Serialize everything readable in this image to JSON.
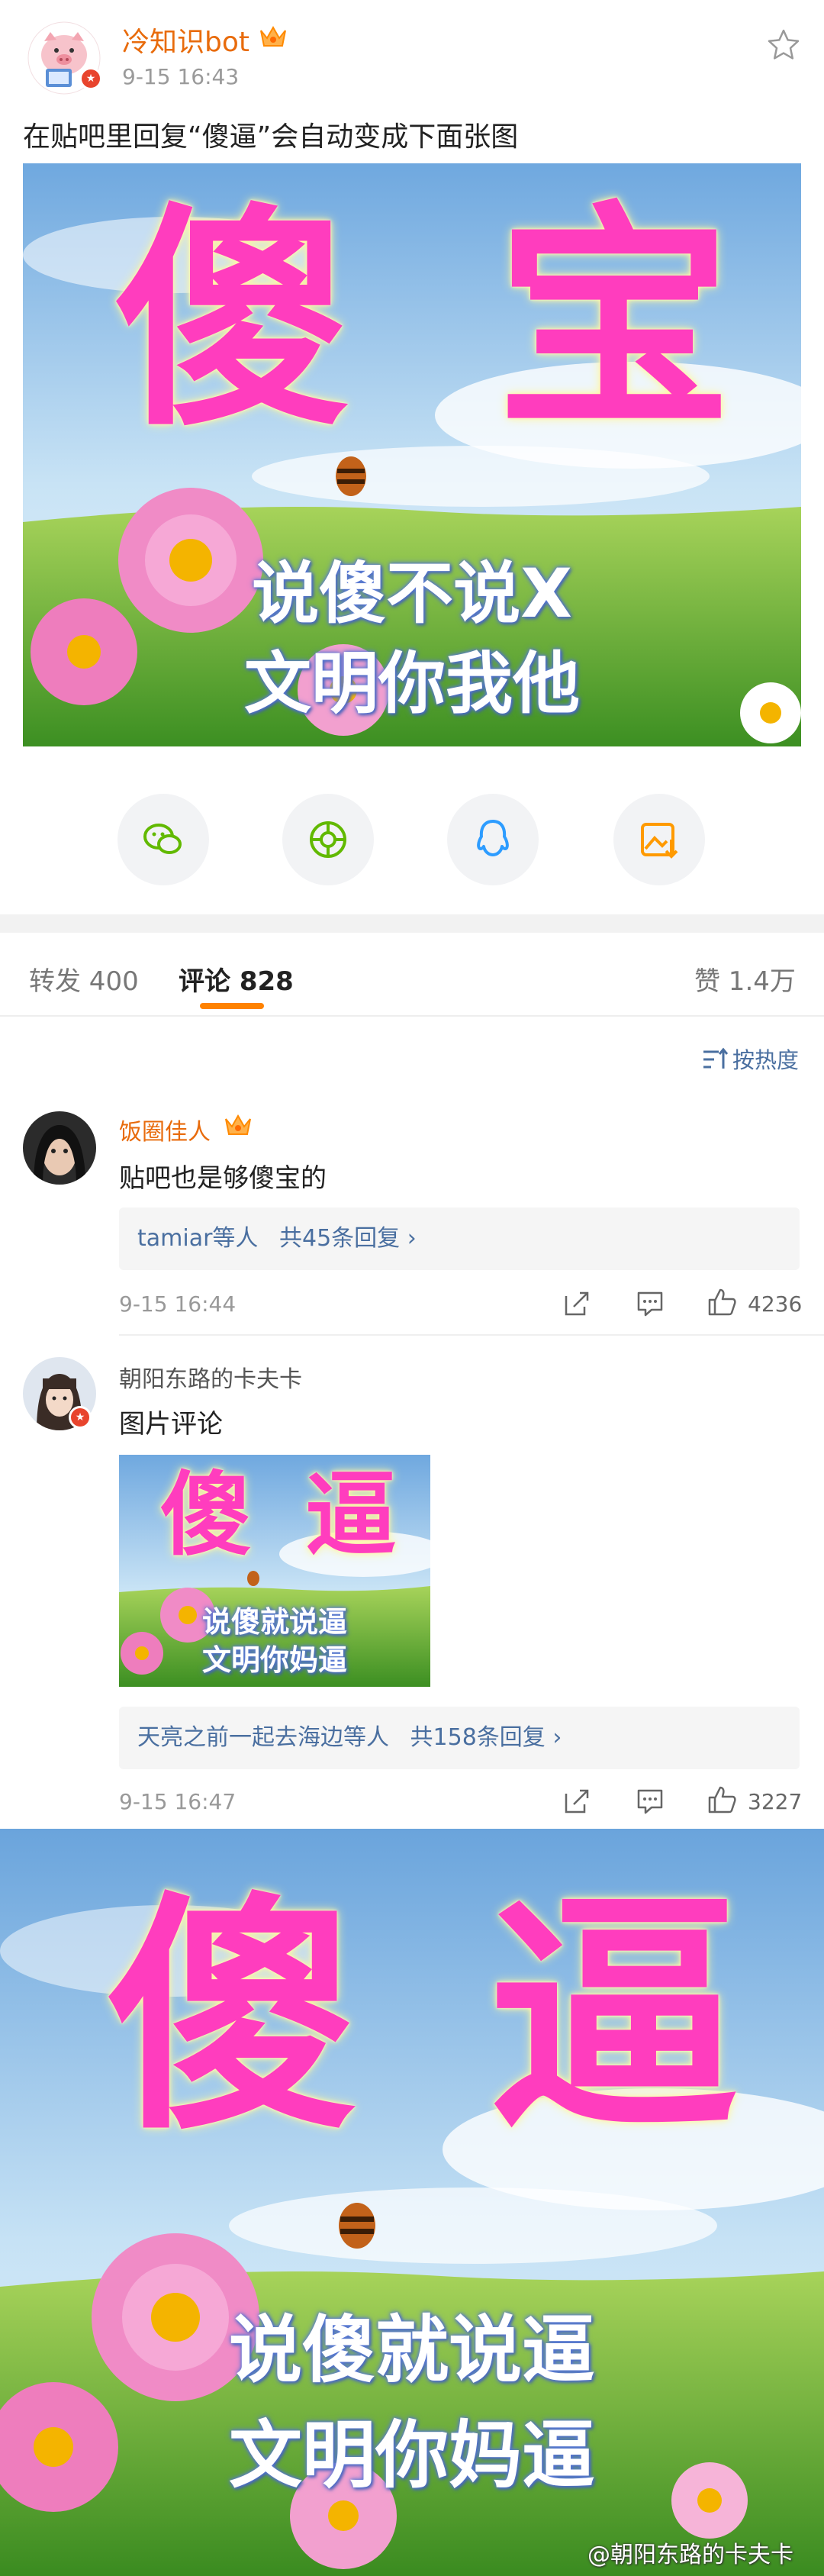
{
  "post": {
    "author": "冷知识bot",
    "time": "9-15 16:43",
    "text": "在贴吧里回复“傻逼”会自动变成下面张图"
  },
  "meme_top": {
    "big_left": "傻",
    "big_right": "宝",
    "line1": "说傻不说X",
    "line2": "文明你我他"
  },
  "share": {
    "icons": [
      "wechat-icon",
      "moments-icon",
      "qq-icon",
      "save-image-icon"
    ],
    "colors": {
      "wechat": "#62b900",
      "moments": "#62b900",
      "qq": "#2d9cff",
      "save": "#ff9a00"
    }
  },
  "tabs": {
    "repost": "转发 400",
    "comment": "评论 828",
    "like": "赞 1.4万"
  },
  "sort": {
    "label": "按热度"
  },
  "comments": [
    {
      "name": "饭圈佳人",
      "text": "贴吧也是够傻宝的",
      "reply_users": "tamiar等人",
      "reply_count": "共45条回复 ›",
      "time": "9-15 16:44",
      "likes": "4236"
    },
    {
      "name": "朝阳东路的卡夫卡",
      "text": "图片评论",
      "reply_users": "天亮之前一起去海边等人",
      "reply_count": "共158条回复 ›",
      "time": "9-15 16:47",
      "likes": "3227"
    }
  ],
  "meme_comment": {
    "big_left": "傻",
    "big_right": "逼",
    "line1": "说傻就说逼",
    "line2": "文明你妈逼"
  },
  "meme_bottom": {
    "big_left": "傻",
    "big_right": "逼",
    "line1": "说傻就说逼",
    "line2": "文明你妈逼"
  },
  "watermark": "@朝阳东路的卡夫卡",
  "colors": {
    "accent": "#ff8200",
    "name_orange": "#e86b0c",
    "link_blue": "#4a6fa0",
    "meme_pink": "#ff3dbe"
  }
}
